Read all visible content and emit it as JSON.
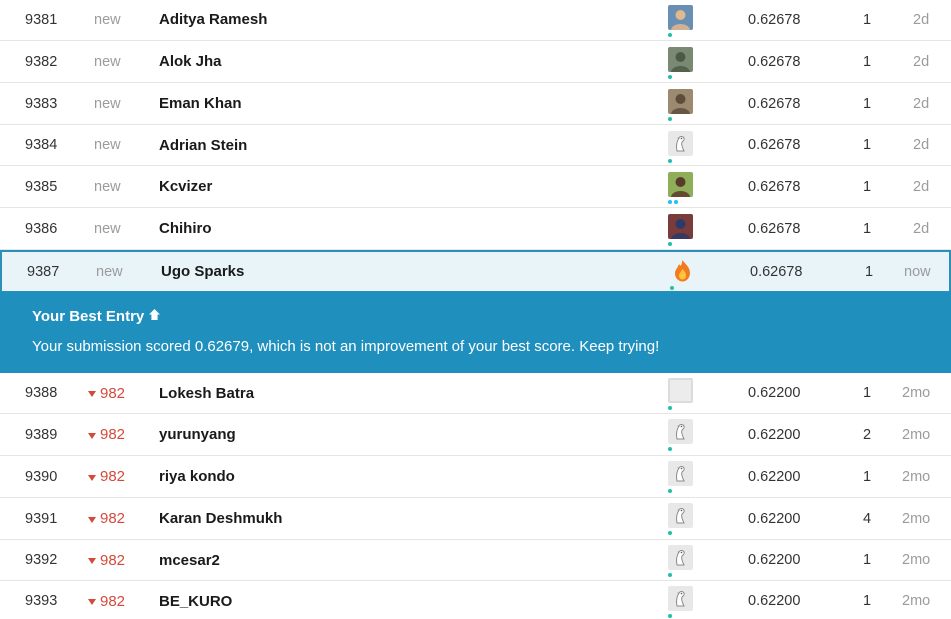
{
  "colors": {
    "banner_bg": "#1f8fbe",
    "current_row_bg": "#e9f4f9",
    "current_row_border": "#2c8fba",
    "rank_down": "#d44a3a",
    "new_text": "#9b9b9b"
  },
  "rows_top": [
    {
      "rank": "9381",
      "change": "new",
      "team": "Aditya Ramesh",
      "avatar": "photo-avatar",
      "score": "0.62678",
      "entries": "1",
      "last": "2d"
    },
    {
      "rank": "9382",
      "change": "new",
      "team": "Alok Jha",
      "avatar": "photo-avatar",
      "score": "0.62678",
      "entries": "1",
      "last": "2d"
    },
    {
      "rank": "9383",
      "change": "new",
      "team": "Eman Khan",
      "avatar": "photo-avatar",
      "score": "0.62678",
      "entries": "1",
      "last": "2d"
    },
    {
      "rank": "9384",
      "change": "new",
      "team": "Adrian Stein",
      "avatar": "default-goose-avatar",
      "score": "0.62678",
      "entries": "1",
      "last": "2d"
    },
    {
      "rank": "9385",
      "change": "new",
      "team": "Kcvizer",
      "avatar": "photo-avatar",
      "score": "0.62678",
      "entries": "1",
      "last": "2d"
    },
    {
      "rank": "9386",
      "change": "new",
      "team": "Chihiro",
      "avatar": "photo-avatar",
      "score": "0.62678",
      "entries": "1",
      "last": "2d"
    }
  ],
  "current_row": {
    "rank": "9387",
    "change": "new",
    "team": "Ugo Sparks",
    "avatar": "flame-avatar",
    "score": "0.62678",
    "entries": "1",
    "last": "now"
  },
  "banner": {
    "title": "Your Best Entry",
    "title_icon": "arrow-up-icon",
    "message": "Your submission scored 0.62679, which is not an improvement of your best score. Keep trying!"
  },
  "rows_bottom": [
    {
      "rank": "9388",
      "change": "982",
      "team": "Lokesh Batra",
      "avatar": "blank-avatar",
      "score": "0.62200",
      "entries": "1",
      "last": "2mo"
    },
    {
      "rank": "9389",
      "change": "982",
      "team": "yurunyang",
      "avatar": "default-goose-avatar",
      "score": "0.62200",
      "entries": "2",
      "last": "2mo"
    },
    {
      "rank": "9390",
      "change": "982",
      "team": "riya kondo",
      "avatar": "default-goose-avatar",
      "score": "0.62200",
      "entries": "1",
      "last": "2mo"
    },
    {
      "rank": "9391",
      "change": "982",
      "team": "Karan Deshmukh",
      "avatar": "default-goose-avatar",
      "score": "0.62200",
      "entries": "4",
      "last": "2mo"
    },
    {
      "rank": "9392",
      "change": "982",
      "team": "mcesar2",
      "avatar": "default-goose-avatar",
      "score": "0.62200",
      "entries": "1",
      "last": "2mo"
    },
    {
      "rank": "9393",
      "change": "982",
      "team": "BE_KURO",
      "avatar": "default-goose-avatar",
      "score": "0.62200",
      "entries": "1",
      "last": "2mo"
    }
  ]
}
